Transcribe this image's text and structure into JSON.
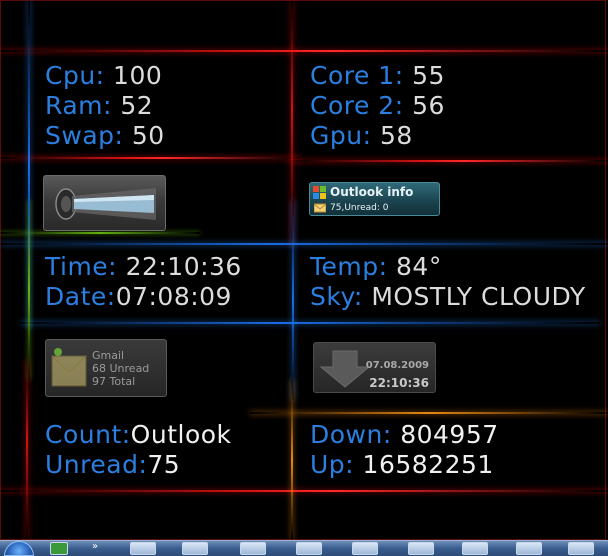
{
  "system": {
    "cpu": {
      "label": "Cpu:",
      "value": "100"
    },
    "ram": {
      "label": "Ram:",
      "value": "52"
    },
    "swap": {
      "label": "Swap:",
      "value": "50"
    }
  },
  "cores": {
    "core1": {
      "label": "Core 1:",
      "value": "55"
    },
    "core2": {
      "label": "Core 2:",
      "value": "56"
    },
    "gpu": {
      "label": "Gpu:",
      "value": "58"
    }
  },
  "datetime": {
    "time": {
      "label": "Time:",
      "value": "22:10:36"
    },
    "date": {
      "label": "Date:",
      "value": "07:08:09"
    }
  },
  "weather": {
    "temp": {
      "label": "Temp:",
      "value": "84°"
    },
    "sky": {
      "label": "Sky:",
      "value": "MOSTLY CLOUDY"
    }
  },
  "mail": {
    "count": {
      "label": "Count:",
      "value": "Outlook"
    },
    "unread": {
      "label": "Unread:",
      "value": "75"
    }
  },
  "network": {
    "down": {
      "label": "Down:",
      "value": "804957"
    },
    "up": {
      "label": "Up:",
      "value": "16582251"
    }
  },
  "outlook_widget": {
    "title": "Outlook info",
    "status": "75,Unread: 0"
  },
  "gmail_widget": {
    "title": "Gmail",
    "unread": "68 Unread",
    "total": "97 Total"
  },
  "download_widget": {
    "date": "07.08.2009",
    "time": "22:10:36"
  },
  "taskbar": {
    "tray_glyph": "»"
  },
  "colors": {
    "label": "#2a7fe0",
    "value": "#dcdcdc",
    "background": "#000000"
  }
}
